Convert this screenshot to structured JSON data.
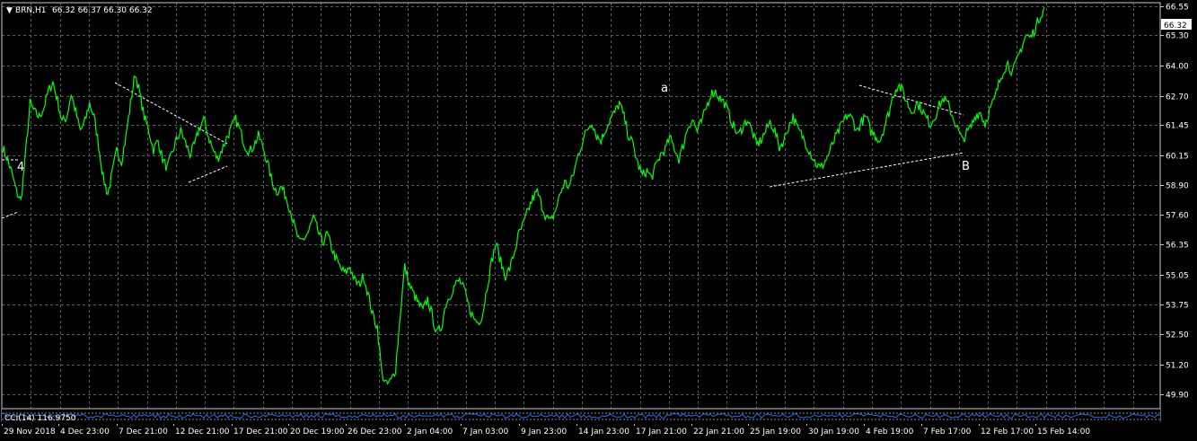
{
  "header": {
    "symbol": "BRN,H1",
    "ohlc": "66.32 66.37 66.30 66.32"
  },
  "indicator": {
    "label": "CCI(14) 116.9750"
  },
  "price_badge": "66.32",
  "colors": {
    "background": "#000000",
    "price_line": "#00ff00",
    "grid": "#5a5a5a",
    "text": "#ffffff",
    "trendline": "#ffffff",
    "indicator_line": "#2a6ff0"
  },
  "chart_data": {
    "type": "line",
    "title": "",
    "xlabel": "",
    "ylabel": "",
    "ylim": [
      49.3,
      66.7
    ],
    "y_ticks": [
      "66.55",
      "65.30",
      "64.00",
      "62.70",
      "61.45",
      "60.15",
      "58.90",
      "57.60",
      "56.35",
      "55.05",
      "53.75",
      "52.50",
      "51.20",
      "49.90"
    ],
    "x_ticks": [
      "29 Nov 2018",
      "4 Dec 23:00",
      "7 Dec 21:00",
      "12 Dec 21:00",
      "17 Dec 21:00",
      "20 Dec 19:00",
      "26 Dec 23:00",
      "2 Jan 04:00",
      "7 Jan 03:00",
      "9 Jan 23:00",
      "14 Jan 23:00",
      "17 Jan 21:00",
      "22 Jan 21:00",
      "25 Jan 19:00",
      "30 Jan 19:00",
      "4 Feb 19:00",
      "7 Feb 17:00",
      "12 Feb 17:00",
      "15 Feb 14:00"
    ],
    "grid": true,
    "series": [
      {
        "values": [
          60.5,
          60.0,
          59.4,
          58.6,
          58.2,
          60.2,
          62.4,
          62.0,
          61.8,
          62.2,
          62.9,
          63.3,
          62.5,
          61.6,
          61.8,
          62.8,
          62.0,
          61.2,
          61.6,
          62.4,
          61.8,
          60.6,
          59.2,
          58.5,
          59.4,
          60.4,
          59.9,
          61.0,
          62.4,
          63.7,
          62.8,
          61.8,
          61.2,
          60.4,
          60.8,
          60.0,
          59.6,
          60.2,
          60.8,
          61.2,
          60.7,
          60.2,
          60.6,
          61.3,
          61.7,
          61.0,
          60.4,
          60.0,
          60.4,
          60.9,
          61.3,
          61.7,
          61.2,
          60.6,
          60.3,
          60.6,
          61.0,
          60.5,
          59.8,
          59.0,
          58.6,
          58.8,
          58.4,
          57.8,
          57.0,
          56.4,
          56.6,
          56.9,
          57.5,
          56.9,
          56.4,
          56.8,
          56.2,
          55.7,
          55.3,
          55.1,
          55.4,
          54.8,
          54.6,
          55.0,
          54.2,
          53.3,
          52.8,
          50.8,
          50.3,
          50.5,
          51.0,
          53.3,
          55.4,
          54.6,
          54.2,
          53.8,
          53.5,
          54.0,
          53.3,
          52.5,
          52.8,
          53.8,
          54.2,
          54.6,
          54.8,
          54.4,
          53.7,
          53.2,
          53.0,
          53.3,
          54.5,
          55.6,
          56.4,
          55.6,
          55.0,
          55.3,
          56.0,
          56.8,
          57.2,
          57.8,
          58.3,
          58.6,
          58.0,
          57.5,
          57.3,
          57.8,
          58.5,
          59.0,
          58.8,
          59.4,
          60.2,
          60.8,
          61.3,
          61.6,
          61.0,
          60.8,
          61.3,
          61.7,
          62.0,
          62.4,
          61.8,
          61.0,
          60.6,
          59.8,
          59.3,
          59.5,
          59.2,
          59.7,
          60.2,
          60.4,
          60.9,
          60.5,
          60.0,
          60.6,
          61.4,
          61.7,
          61.2,
          61.6,
          62.2,
          62.8,
          62.9,
          62.6,
          62.4,
          61.9,
          61.4,
          61.0,
          61.4,
          61.7,
          61.2,
          60.6,
          60.8,
          61.2,
          61.6,
          61.2,
          60.5,
          60.8,
          61.4,
          61.8,
          61.3,
          61.0,
          60.6,
          60.2,
          59.8,
          59.6,
          59.9,
          60.3,
          60.8,
          61.2,
          61.6,
          61.9,
          61.7,
          61.2,
          61.6,
          61.8,
          61.2,
          61.0,
          60.8,
          61.4,
          62.0,
          62.8,
          63.2,
          62.9,
          62.4,
          62.0,
          62.4,
          62.2,
          61.8,
          61.5,
          61.8,
          62.3,
          62.6,
          62.3,
          61.8,
          61.3,
          60.8,
          61.1,
          61.4,
          61.9,
          62.0,
          61.5,
          62.1,
          62.5,
          63.2,
          63.8,
          64.1,
          63.7,
          64.2,
          64.8,
          65.3,
          65.2,
          65.6,
          66.1,
          66.5
        ]
      }
    ]
  }
}
